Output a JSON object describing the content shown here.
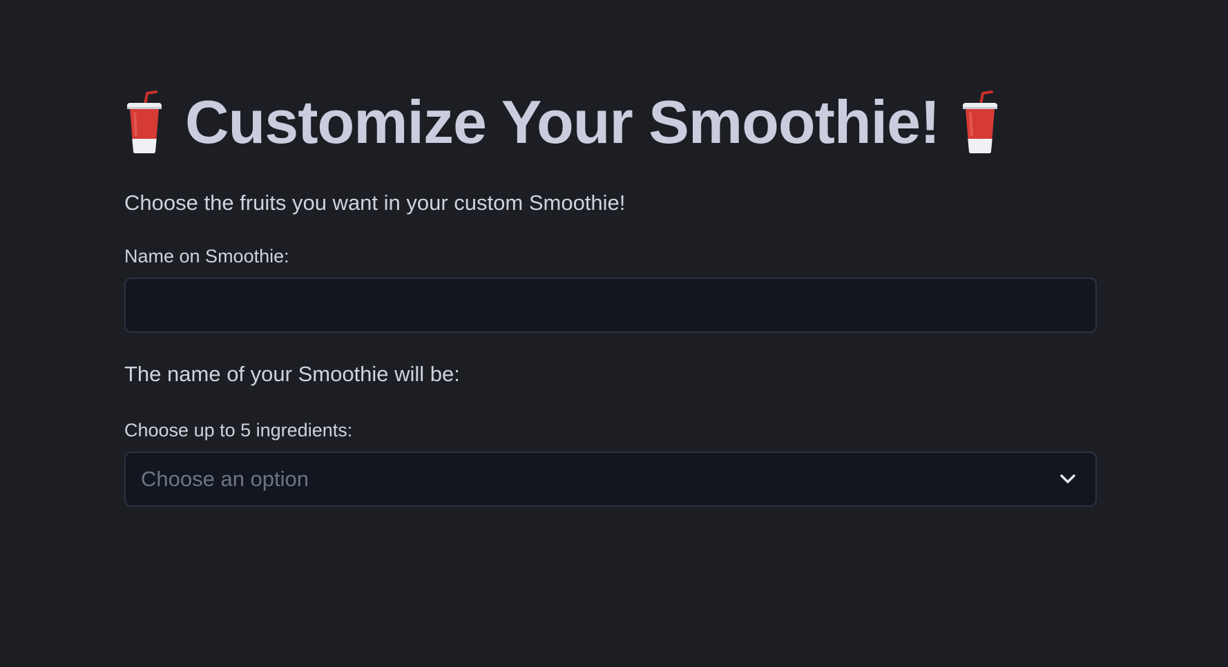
{
  "header": {
    "title": "Customize Your Smoothie!",
    "left_icon": "cup-with-straw-icon",
    "right_icon": "cup-with-straw-icon",
    "subtitle": "Choose the fruits you want in your custom Smoothie!"
  },
  "name_field": {
    "label": "Name on Smoothie:",
    "value": "",
    "placeholder": ""
  },
  "name_preview": {
    "text": "The name of your Smoothie will be:"
  },
  "ingredients_field": {
    "label": "Choose up to 5 ingredients:",
    "placeholder": "Choose an option",
    "icon": "chevron-down-icon"
  },
  "colors": {
    "background": "#1c1e24",
    "input_background": "#11161f",
    "input_border": "#2b3240",
    "title_text": "#c9cdde",
    "body_text": "#cfd3de",
    "placeholder_text": "#6e7584",
    "cup_red": "#d63a35"
  }
}
